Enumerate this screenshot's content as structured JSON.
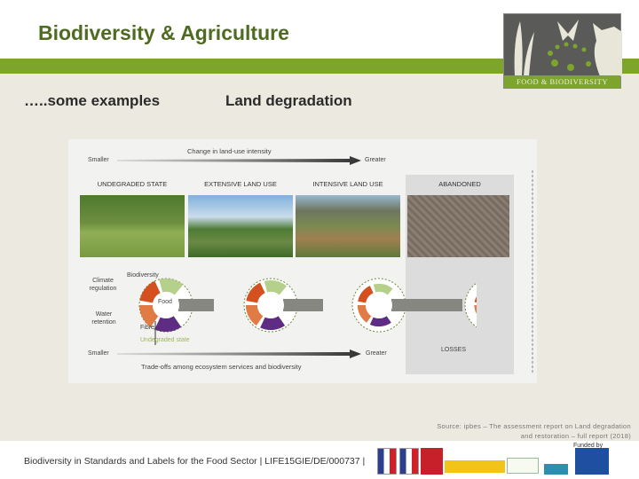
{
  "header": {
    "title": "Biodiversity & Agriculture",
    "logo_text": "FOOD & BIODIVERSITY"
  },
  "slide": {
    "subtitle_left": "…..some examples",
    "subtitle_right": "Land degradation"
  },
  "diagram": {
    "top_axis": {
      "label": "Change in land-use intensity",
      "left": "Smaller",
      "right": "Greater"
    },
    "states": [
      "UNDEGRADED STATE",
      "EXTENSIVE LAND USE",
      "INTENSIVE LAND USE",
      "ABANDONED"
    ],
    "services": {
      "climate": "Climate regulation",
      "biodiversity": "Biodiversity",
      "food": "Food",
      "water": "Water retention",
      "fibre": "Fibre",
      "state_label": "Undegraded state"
    },
    "losses": "LOSSES",
    "bottom_axis": {
      "label": "Trade-offs among ecosystem services and biodiversity",
      "left": "Smaller",
      "right": "Greater"
    },
    "colors": {
      "climate": "#d4501f",
      "biodiversity": "#b5d08a",
      "food": "#858780",
      "water": "#e07b45",
      "fibre": "#5e2d83"
    }
  },
  "source": {
    "line1": "Source: ipbes – The assessment report on Land degradation",
    "line2": "and restoration – full report (2018)"
  },
  "footer": {
    "text": "Biodiversity in Standards and Labels for the Food Sector | LIFE15GIE/DE/000737 |",
    "funded_by": "Funded by"
  }
}
